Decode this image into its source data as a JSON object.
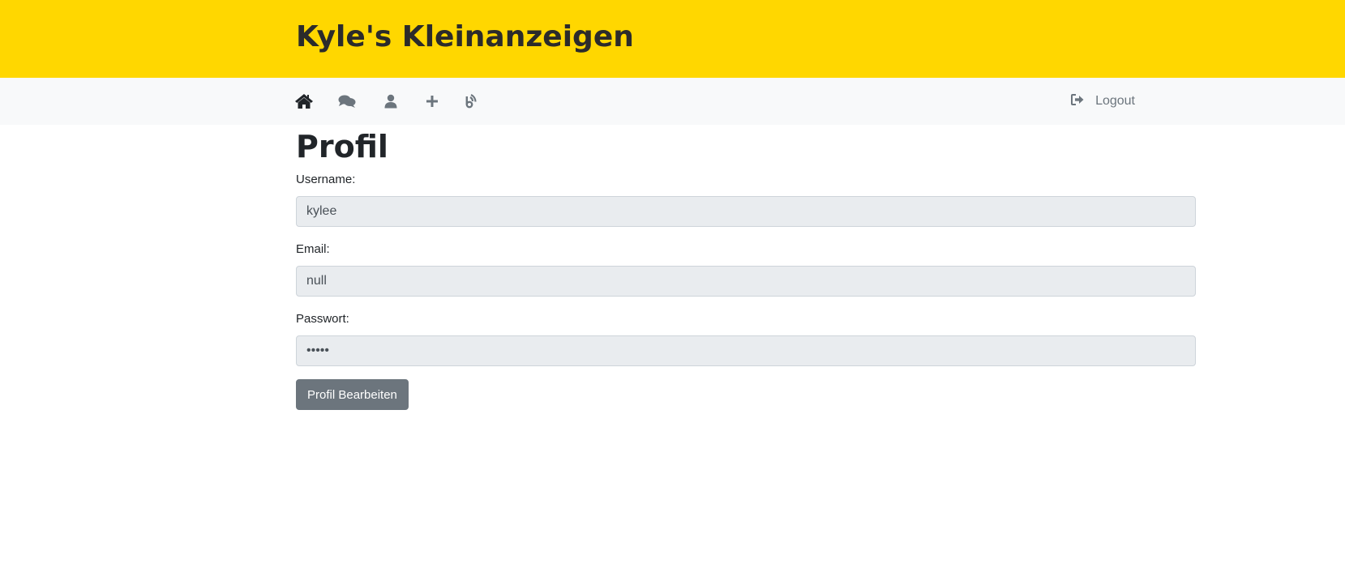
{
  "header": {
    "site_title": "Kyle's Kleinanzeigen",
    "background_color": "#ffd700"
  },
  "nav": {
    "icons": [
      {
        "name": "home-icon",
        "active": true
      },
      {
        "name": "messages-icon",
        "active": false
      },
      {
        "name": "user-icon",
        "active": false
      },
      {
        "name": "plus-icon",
        "active": false
      },
      {
        "name": "feed-icon",
        "active": false
      }
    ],
    "logout_label": "Logout",
    "logout_icon": "sign-out-icon"
  },
  "page": {
    "title": "Profil"
  },
  "form": {
    "username_label": "Username:",
    "username_value": "kylee",
    "email_label": "Email:",
    "email_value": "null",
    "password_label": "Passwort:",
    "password_value": "•••••",
    "edit_button_label": "Profil Bearbeiten"
  },
  "colors": {
    "accent": "#ffd700",
    "button": "#6c757d",
    "input_bg": "#e9ecef",
    "nav_bg": "#f8f9fa"
  }
}
